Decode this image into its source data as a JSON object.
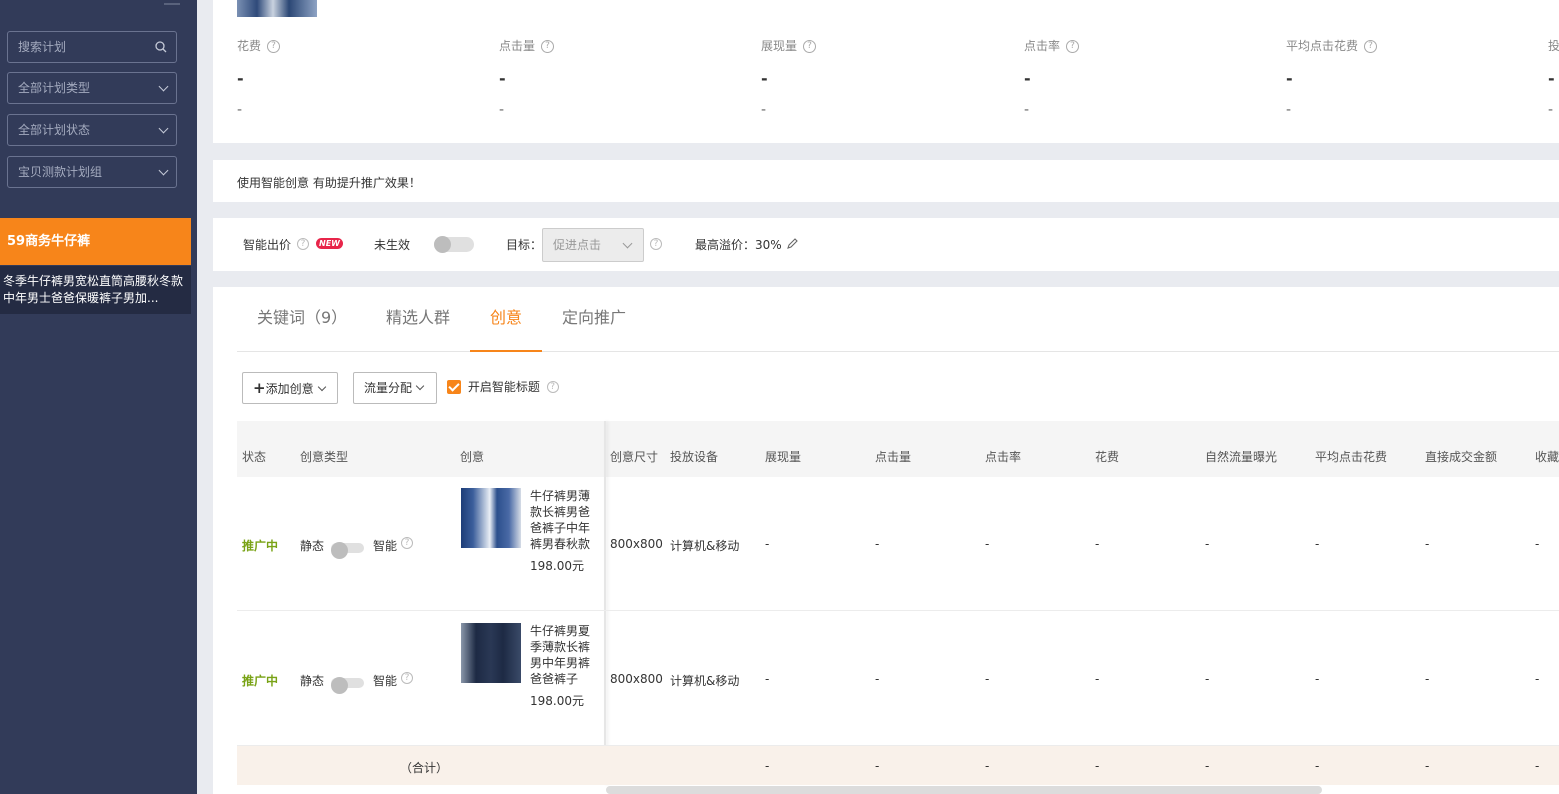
{
  "sidebar": {
    "search_placeholder": "搜索计划",
    "plan_type": "全部计划类型",
    "plan_status": "全部计划状态",
    "plan_group": "宝贝测款计划组",
    "active_plan": "59商务牛仔裤",
    "active_item": "冬季牛仔裤男宽松直筒高腰秋冬款中年男士爸爸保暖裤子男加..."
  },
  "metrics": [
    {
      "label": "花费",
      "v1": "-",
      "v2": "-"
    },
    {
      "label": "点击量",
      "v1": "-",
      "v2": "-"
    },
    {
      "label": "展现量",
      "v1": "-",
      "v2": "-"
    },
    {
      "label": "点击率",
      "v1": "-",
      "v2": "-"
    },
    {
      "label": "平均点击花费",
      "v1": "-",
      "v2": "-"
    },
    {
      "label": "投",
      "v1": "-",
      "v2": "-"
    }
  ],
  "smart_creative_tip": "使用智能创意  有助提升推广效果！",
  "bidding": {
    "smart_bid_label": "智能出价",
    "new_badge": "NEW",
    "status": "未生效",
    "target_label": "目标：",
    "target_value": "促进点击",
    "max_premium": "最高溢价：30%"
  },
  "tabs": [
    {
      "label": "关键词（9）"
    },
    {
      "label": "精选人群"
    },
    {
      "label": "创意"
    },
    {
      "label": "定向推广"
    }
  ],
  "toolbar": {
    "add_creative": "添加创意",
    "traffic_split": "流量分配",
    "smart_title": "开启智能标题"
  },
  "table": {
    "headers": [
      "状态",
      "创意类型",
      "创意",
      "创意尺寸",
      "投放设备",
      "展现量",
      "点击量",
      "点击率",
      "花费",
      "自然流量曝光",
      "平均点击花费",
      "直接成交金额",
      "收藏"
    ],
    "rows": [
      {
        "status": "推广中",
        "type_static": "静态",
        "type_smart": "智能",
        "title": "牛仔裤男薄款长裤男爸爸裤子中年裤男春秋款",
        "price": "198.00元",
        "size": "800x800",
        "device": "计算机&移动",
        "values": [
          "-",
          "-",
          "-",
          "-",
          "-",
          "-",
          "-",
          "-"
        ]
      },
      {
        "status": "推广中",
        "type_static": "静态",
        "type_smart": "智能",
        "title": "牛仔裤男夏季薄款长裤男中年男裤爸爸裤子",
        "price": "198.00元",
        "size": "800x800",
        "device": "计算机&移动",
        "values": [
          "-",
          "-",
          "-",
          "-",
          "-",
          "-",
          "-",
          "-"
        ]
      }
    ],
    "total_label": "（合计）",
    "total_values": [
      "-",
      "-",
      "-",
      "-",
      "-",
      "-",
      "-",
      "-"
    ]
  }
}
